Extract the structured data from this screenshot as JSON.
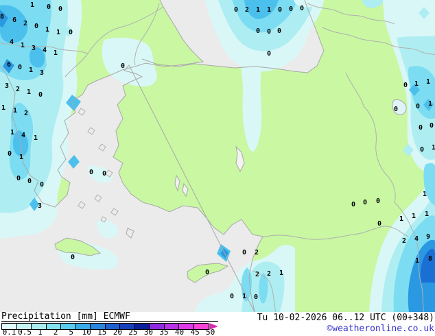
{
  "legend": {
    "title": "Precipitation [mm] ECMWF",
    "scale_labels": [
      "0.1",
      "0.5",
      "1",
      "2",
      "5",
      "10",
      "15",
      "20",
      "25",
      "30",
      "35",
      "40",
      "45",
      "50"
    ],
    "scale_colors": [
      "#e2fbfb",
      "#c6f5f5",
      "#a9eded",
      "#83e1f0",
      "#58ccee",
      "#38ace8",
      "#2a86dc",
      "#2061d2",
      "#1540ba",
      "#0c209e",
      "#8e2ae0",
      "#b832e6",
      "#dd3ae8",
      "#f544d6"
    ],
    "arrow_color": "#d62bb0",
    "timestamp": "Tu 10-02-2026 06..12 UTC (00+348)",
    "copyright": "©weatheronline.co.uk"
  },
  "map": {
    "colors": {
      "sea": "#ebebeb",
      "land": "#c9f7a2",
      "coast": "#a8a8a8",
      "border": "#b0b0b0",
      "lake": "#f3f3f3",
      "lake_wet": "#dff4f6",
      "island": "#ececec",
      "precip_pale": "#daf7f7",
      "precip_light": "#aeeef2",
      "precip_mid": "#7cdcf2",
      "precip_bright": "#4cc0ec",
      "precip_strong": "#2b99e2",
      "precip_core": "#1a6fd4"
    },
    "values": [
      [
        47,
        8,
        "1"
      ],
      [
        71,
        11,
        "0"
      ],
      [
        88,
        14,
        "0"
      ],
      [
        103,
        48,
        "0"
      ],
      [
        3,
        25,
        "8"
      ],
      [
        21,
        30,
        "6"
      ],
      [
        37,
        35,
        "2"
      ],
      [
        53,
        39,
        "0"
      ],
      [
        69,
        44,
        "1"
      ],
      [
        85,
        48,
        "1"
      ],
      [
        17,
        62,
        "4"
      ],
      [
        33,
        67,
        "1"
      ],
      [
        49,
        71,
        "3"
      ],
      [
        65,
        74,
        "4"
      ],
      [
        81,
        78,
        "1"
      ],
      [
        13,
        95,
        "6"
      ],
      [
        29,
        99,
        "0"
      ],
      [
        45,
        103,
        "1"
      ],
      [
        61,
        107,
        "3"
      ],
      [
        179,
        97,
        "0"
      ],
      [
        344,
        15,
        "0"
      ],
      [
        360,
        15,
        "2"
      ],
      [
        376,
        15,
        "1"
      ],
      [
        392,
        15,
        "1"
      ],
      [
        408,
        15,
        "0"
      ],
      [
        424,
        14,
        "0"
      ],
      [
        440,
        13,
        "0"
      ],
      [
        376,
        46,
        "0"
      ],
      [
        392,
        47,
        "0"
      ],
      [
        407,
        46,
        "0"
      ],
      [
        392,
        79,
        "0"
      ],
      [
        10,
        126,
        "3"
      ],
      [
        26,
        131,
        "2"
      ],
      [
        42,
        135,
        "1"
      ],
      [
        59,
        139,
        "0"
      ],
      [
        5,
        158,
        "1"
      ],
      [
        22,
        162,
        "1"
      ],
      [
        38,
        166,
        "2"
      ],
      [
        18,
        194,
        "1"
      ],
      [
        34,
        198,
        "4"
      ],
      [
        52,
        202,
        "1"
      ],
      [
        14,
        225,
        "0"
      ],
      [
        31,
        230,
        "1"
      ],
      [
        27,
        261,
        "0"
      ],
      [
        43,
        265,
        "0"
      ],
      [
        61,
        270,
        "0"
      ],
      [
        133,
        252,
        "0"
      ],
      [
        152,
        254,
        "0"
      ],
      [
        58,
        301,
        "3"
      ],
      [
        106,
        376,
        "0"
      ],
      [
        591,
        125,
        "0"
      ],
      [
        607,
        123,
        "1"
      ],
      [
        624,
        120,
        "1"
      ],
      [
        577,
        160,
        "0"
      ],
      [
        609,
        156,
        "0"
      ],
      [
        627,
        152,
        "1"
      ],
      [
        613,
        187,
        "0"
      ],
      [
        629,
        184,
        "0"
      ],
      [
        615,
        219,
        "0"
      ],
      [
        632,
        216,
        "1"
      ],
      [
        619,
        284,
        "1"
      ],
      [
        585,
        320,
        "1"
      ],
      [
        603,
        316,
        "1"
      ],
      [
        622,
        313,
        "1"
      ],
      [
        589,
        352,
        "2"
      ],
      [
        607,
        349,
        "4"
      ],
      [
        624,
        346,
        "9"
      ],
      [
        608,
        381,
        "1"
      ],
      [
        627,
        378,
        "8"
      ],
      [
        515,
        299,
        "0"
      ],
      [
        532,
        296,
        "0"
      ],
      [
        551,
        294,
        "0"
      ],
      [
        553,
        327,
        "0"
      ],
      [
        356,
        369,
        "0"
      ],
      [
        374,
        369,
        "2"
      ],
      [
        302,
        398,
        "0"
      ],
      [
        375,
        401,
        "2"
      ],
      [
        392,
        400,
        "2"
      ],
      [
        410,
        399,
        "1"
      ],
      [
        338,
        433,
        "0"
      ],
      [
        356,
        433,
        "1"
      ],
      [
        373,
        434,
        "0"
      ]
    ]
  }
}
